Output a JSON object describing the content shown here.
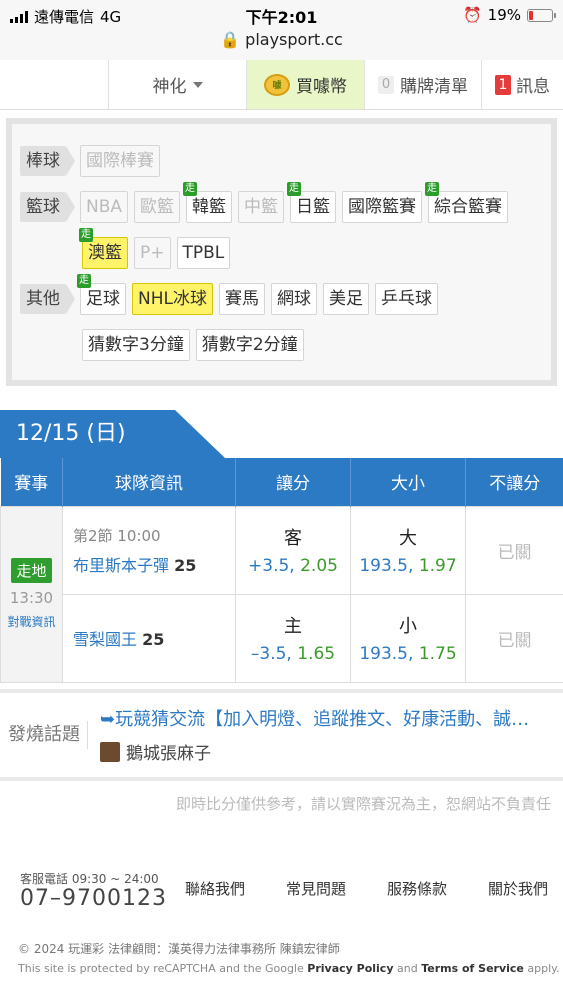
{
  "status_bar": {
    "carrier": "遠傳電信",
    "network": "4G",
    "time": "下午2:01",
    "battery": "19%",
    "url": "playsport.cc"
  },
  "topnav": {
    "god_label": "神化",
    "buy_label": "買噱幣",
    "coin_text": "噱",
    "list_count": "0",
    "list_label": "購牌清單",
    "msg_count": "1",
    "msg_label": "訊息"
  },
  "categories": {
    "baseball": {
      "head": "棒球",
      "items": [
        "國際棒賽"
      ]
    },
    "basketball": {
      "head": "籃球",
      "items": [
        "NBA",
        "歐籃",
        "韓籃",
        "中籃",
        "日籃",
        "國際籃賽",
        "綜合籃賽"
      ],
      "row2": [
        "澳籃",
        "P+",
        "TPBL"
      ]
    },
    "other": {
      "head": "其他",
      "items": [
        "足球",
        "NHL冰球",
        "賽馬",
        "網球",
        "美足",
        "乒乓球"
      ],
      "row2": [
        "猜數字3分鐘",
        "猜數字2分鐘"
      ]
    },
    "live_tag": "走"
  },
  "date_tab": "12/15 (日)",
  "table": {
    "headers": [
      "賽事",
      "球隊資訊",
      "讓分",
      "大小",
      "不讓分"
    ],
    "live_label": "走地",
    "time": "13:30",
    "vs_link": "對戰資訊",
    "period": "第2節 10:00",
    "teams": [
      {
        "name": "布里斯本子彈",
        "score": "25",
        "spread_side": "客",
        "spread_line": "+3.5,",
        "spread_odds": "2.05",
        "ou_side": "大",
        "ou_line": "193.5,",
        "ou_odds": "1.97",
        "ml": "已關"
      },
      {
        "name": "雪梨國王",
        "score": "25",
        "spread_side": "主",
        "spread_line": "–3.5,",
        "spread_odds": "1.65",
        "ou_side": "小",
        "ou_line": "193.5,",
        "ou_odds": "1.75",
        "ml": "已關"
      }
    ]
  },
  "hot": {
    "label": "發燒話題",
    "title": "➥玩競猜交流【加入明燈、追蹤推文、好康活動、誠…",
    "author": "鵝城張麻子"
  },
  "disclaimer": "即時比分僅供參考，請以實際賽況為主，恕網站不負責任",
  "footer": {
    "service_hours": "客服電話 09:30 ~ 24:00",
    "phone": "07–9700123",
    "links": [
      "聯絡我們",
      "常見問題",
      "服務條款",
      "關於我們"
    ],
    "copyright": "© 2024 玩運彩 法律顧問：漢英得力法律事務所 陳鎮宏律師",
    "recaptcha_pre": "This site is protected by reCAPTCHA and the Google",
    "privacy": "Privacy Policy",
    "and": "and",
    "terms": "Terms of Service",
    "apply": "apply."
  }
}
